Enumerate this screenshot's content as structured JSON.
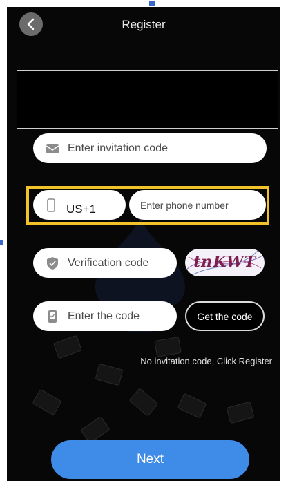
{
  "header": {
    "title": "Register",
    "back_icon": "chevron-left-icon"
  },
  "form": {
    "invitation_placeholder": "Enter invitation code",
    "country_code": "US+1",
    "phone_placeholder": "Enter phone number",
    "verification_placeholder": "Verification code",
    "captcha_text": "tnKWT",
    "sms_code_placeholder": "Enter the code",
    "get_code_label": "Get the code",
    "no_invitation_text": "No invitation code, Click Register"
  },
  "actions": {
    "next_label": "Next"
  },
  "colors": {
    "background": "#070707",
    "primary": "#3f8be8",
    "highlight": "#f2c22b",
    "field": "#ffffff"
  }
}
